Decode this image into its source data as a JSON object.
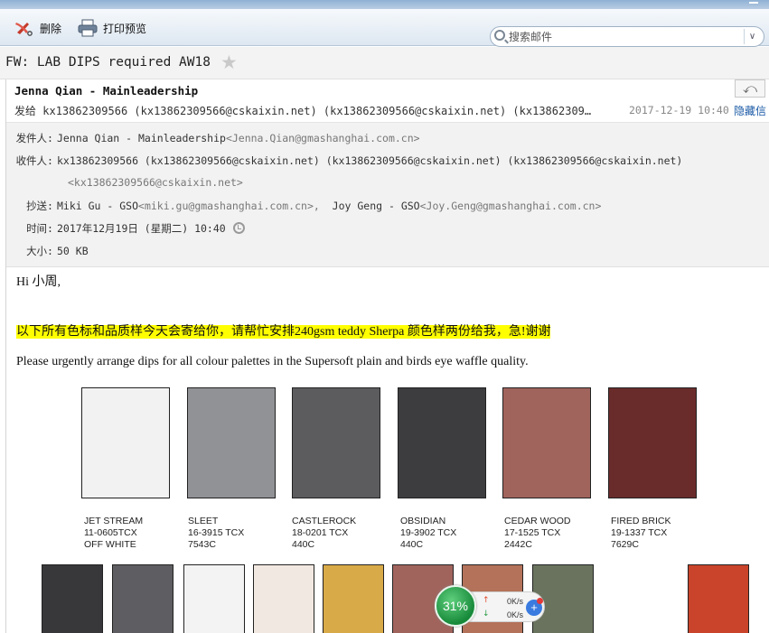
{
  "toolbar": {
    "delete_label": "删除",
    "print_label": "打印预览"
  },
  "search": {
    "placeholder": "搜索邮件",
    "dropdown_icon": "chevron-down-icon"
  },
  "subject": {
    "text": "FW: LAB DIPS required AW18",
    "star_icon": "star-icon"
  },
  "header": {
    "sender": "Jenna Qian - Mainleadership",
    "to_prefix": "发给",
    "to_text": "kx13862309566 (kx13862309566@cskaixin.net) (kx13862309566@cskaixin.net) (kx13862309566…",
    "date": "2017-12-19 10:40",
    "hide_label": "隐藏信"
  },
  "details": {
    "from_label": "发件人:",
    "from_name": "Jenna Qian - Mainleadership",
    "from_addr": "<Jenna.Qian@gmashanghai.com.cn>",
    "to_label": "收件人:",
    "to_text": "kx13862309566 (kx13862309566@cskaixin.net) (kx13862309566@cskaixin.net) (kx13862309566@cskaixin.net)",
    "to_addr": "<kx13862309566@cskaixin.net>",
    "cc_label": "抄送:",
    "cc_name1": "Miki Gu - GSO",
    "cc_addr1": "<miki.gu@gmashanghai.com.cn>,",
    "cc_name2": "Joy Geng - GSO",
    "cc_addr2": "<Joy.Geng@gmashanghai.com.cn>",
    "time_label": "时间:",
    "time_value": "2017年12月19日 (星期二) 10:40",
    "size_label": "大小:",
    "size_value": "50 KB"
  },
  "body": {
    "greeting": "Hi 小周,",
    "highlight_line": "以下所有色标和品质样今天会寄给你，请帮忙安排240gsm teddy Sherpa 颜色样两份给我，急!谢谢",
    "instruction": "Please urgently arrange dips for all colour palettes in the Supersoft plain and birds eye waffle quality."
  },
  "swatches_row1": [
    {
      "name": "JET STREAM",
      "code": "11-0605TCX",
      "extra": "OFF WHITE",
      "color": "#f2f2f2"
    },
    {
      "name": "SLEET",
      "code": "16-3915 TCX",
      "extra": "7543C",
      "color": "#919296"
    },
    {
      "name": "CASTLEROCK",
      "code": "18-0201 TCX",
      "extra": "440C",
      "color": "#5c5c5f"
    },
    {
      "name": "OBSIDIAN",
      "code": "19-3902 TCX",
      "extra": "440C",
      "color": "#3d3d40"
    },
    {
      "name": "CEDAR WOOD",
      "code": "17-1525 TCX",
      "extra": "2442C",
      "color": "#a1645d"
    },
    {
      "name": "FIRED BRICK",
      "code": "19-1337 TCX",
      "extra": "7629C",
      "color": "#6a2c2b"
    }
  ],
  "swatches_row2_colors": [
    "#38383b",
    "#5e5e62",
    "#f3f3f3",
    "#f2e8e2",
    "#d8aa48",
    "#a1645d",
    "#b37259",
    "#6a735e",
    "#c9442a"
  ],
  "net_widget": {
    "percent": "31%",
    "up_speed": "0K/s",
    "down_speed": "0K/s"
  }
}
